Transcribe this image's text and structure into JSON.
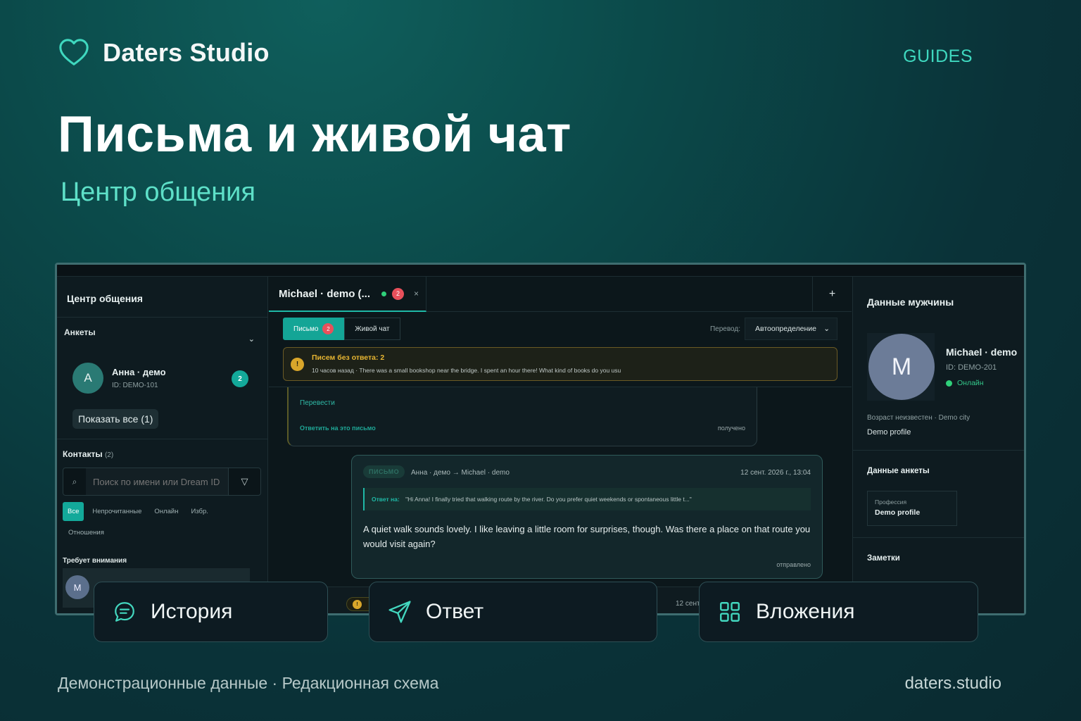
{
  "brand": {
    "name": "Daters Studio",
    "icon": "heart-outline-icon"
  },
  "nav": {
    "guides": "GUIDES"
  },
  "hero": {
    "title": "Письма и живой чат",
    "subtitle": "Центр общения"
  },
  "app": {
    "left": {
      "header": "Центр общения",
      "profiles_section": "Анкеты",
      "profile": {
        "avatar_letter": "A",
        "name": "Анна · демо",
        "id": "ID: DEMO-101",
        "unread": "2"
      },
      "show_all": "Показать все (1)",
      "contacts_label": "Контакты",
      "contacts_count": "(2)",
      "search_placeholder": "Поиск по имени или Dream ID",
      "filters": [
        "Все",
        "Непрочитанные",
        "Онлайн",
        "Избр."
      ],
      "filters_row2": "Отношения",
      "attention_label": "Требует внимания",
      "attention_avatar": "M"
    },
    "center": {
      "tab_title": "Michael · demo (...",
      "tab_badge": "2",
      "tab_close": "×",
      "tab_add": "+",
      "mode_letter": "Письмо",
      "mode_letter_badge": "2",
      "mode_live": "Живой чат",
      "translate_label": "Перевод:",
      "translate_value": "Автоопределение",
      "alert": {
        "icon": "!",
        "title": "Писем без ответа: 2",
        "text": "10 часов назад · There was a small bookshop near the bridge. I spent an hour there! What kind of books do you usu"
      },
      "prev_message": {
        "translate": "Перевести",
        "reply": "Ответить на это письмо",
        "status": "получено"
      },
      "out_message": {
        "tag": "ПИСЬМО",
        "route": "Анна · демо → Michael · demo",
        "date": "12 сент. 2026 г., 13:04",
        "quote_label": "Ответ на:",
        "quote_text": "\"Hi Anna! I finally tried that walking route by the river. Do you prefer quiet weekends or spontaneous little t...\"",
        "body": "A quiet walk sounds lovely. I like leaving a little room for surprises, though. Was there a place on that route you would visit again?",
        "status": "отправлено"
      },
      "bottom_date": "12 сент"
    },
    "right": {
      "title": "Данные мужчины",
      "avatar_letter": "M",
      "name": "Michael · demo",
      "id": "ID: DEMO-201",
      "online": "Онлайн",
      "meta": "Возраст неизвестен  ·  Demo city",
      "demo_profile": "Demo profile",
      "profile_data_title": "Данные анкеты",
      "field_label": "Профессия",
      "field_value": "Demo profile",
      "notes_title": "Заметки"
    }
  },
  "features": [
    {
      "icon": "chat-bubble-icon",
      "label": "История"
    },
    {
      "icon": "send-plane-icon",
      "label": "Ответ"
    },
    {
      "icon": "grid-icon",
      "label": "Вложения"
    }
  ],
  "footer": {
    "left": "Демонстрационные данные · Редакционная схема",
    "right": "daters.studio"
  },
  "colors": {
    "accent": "#3fd8bf",
    "teal_button": "#14a596",
    "alert": "#e8b632",
    "online": "#2fd07a"
  }
}
